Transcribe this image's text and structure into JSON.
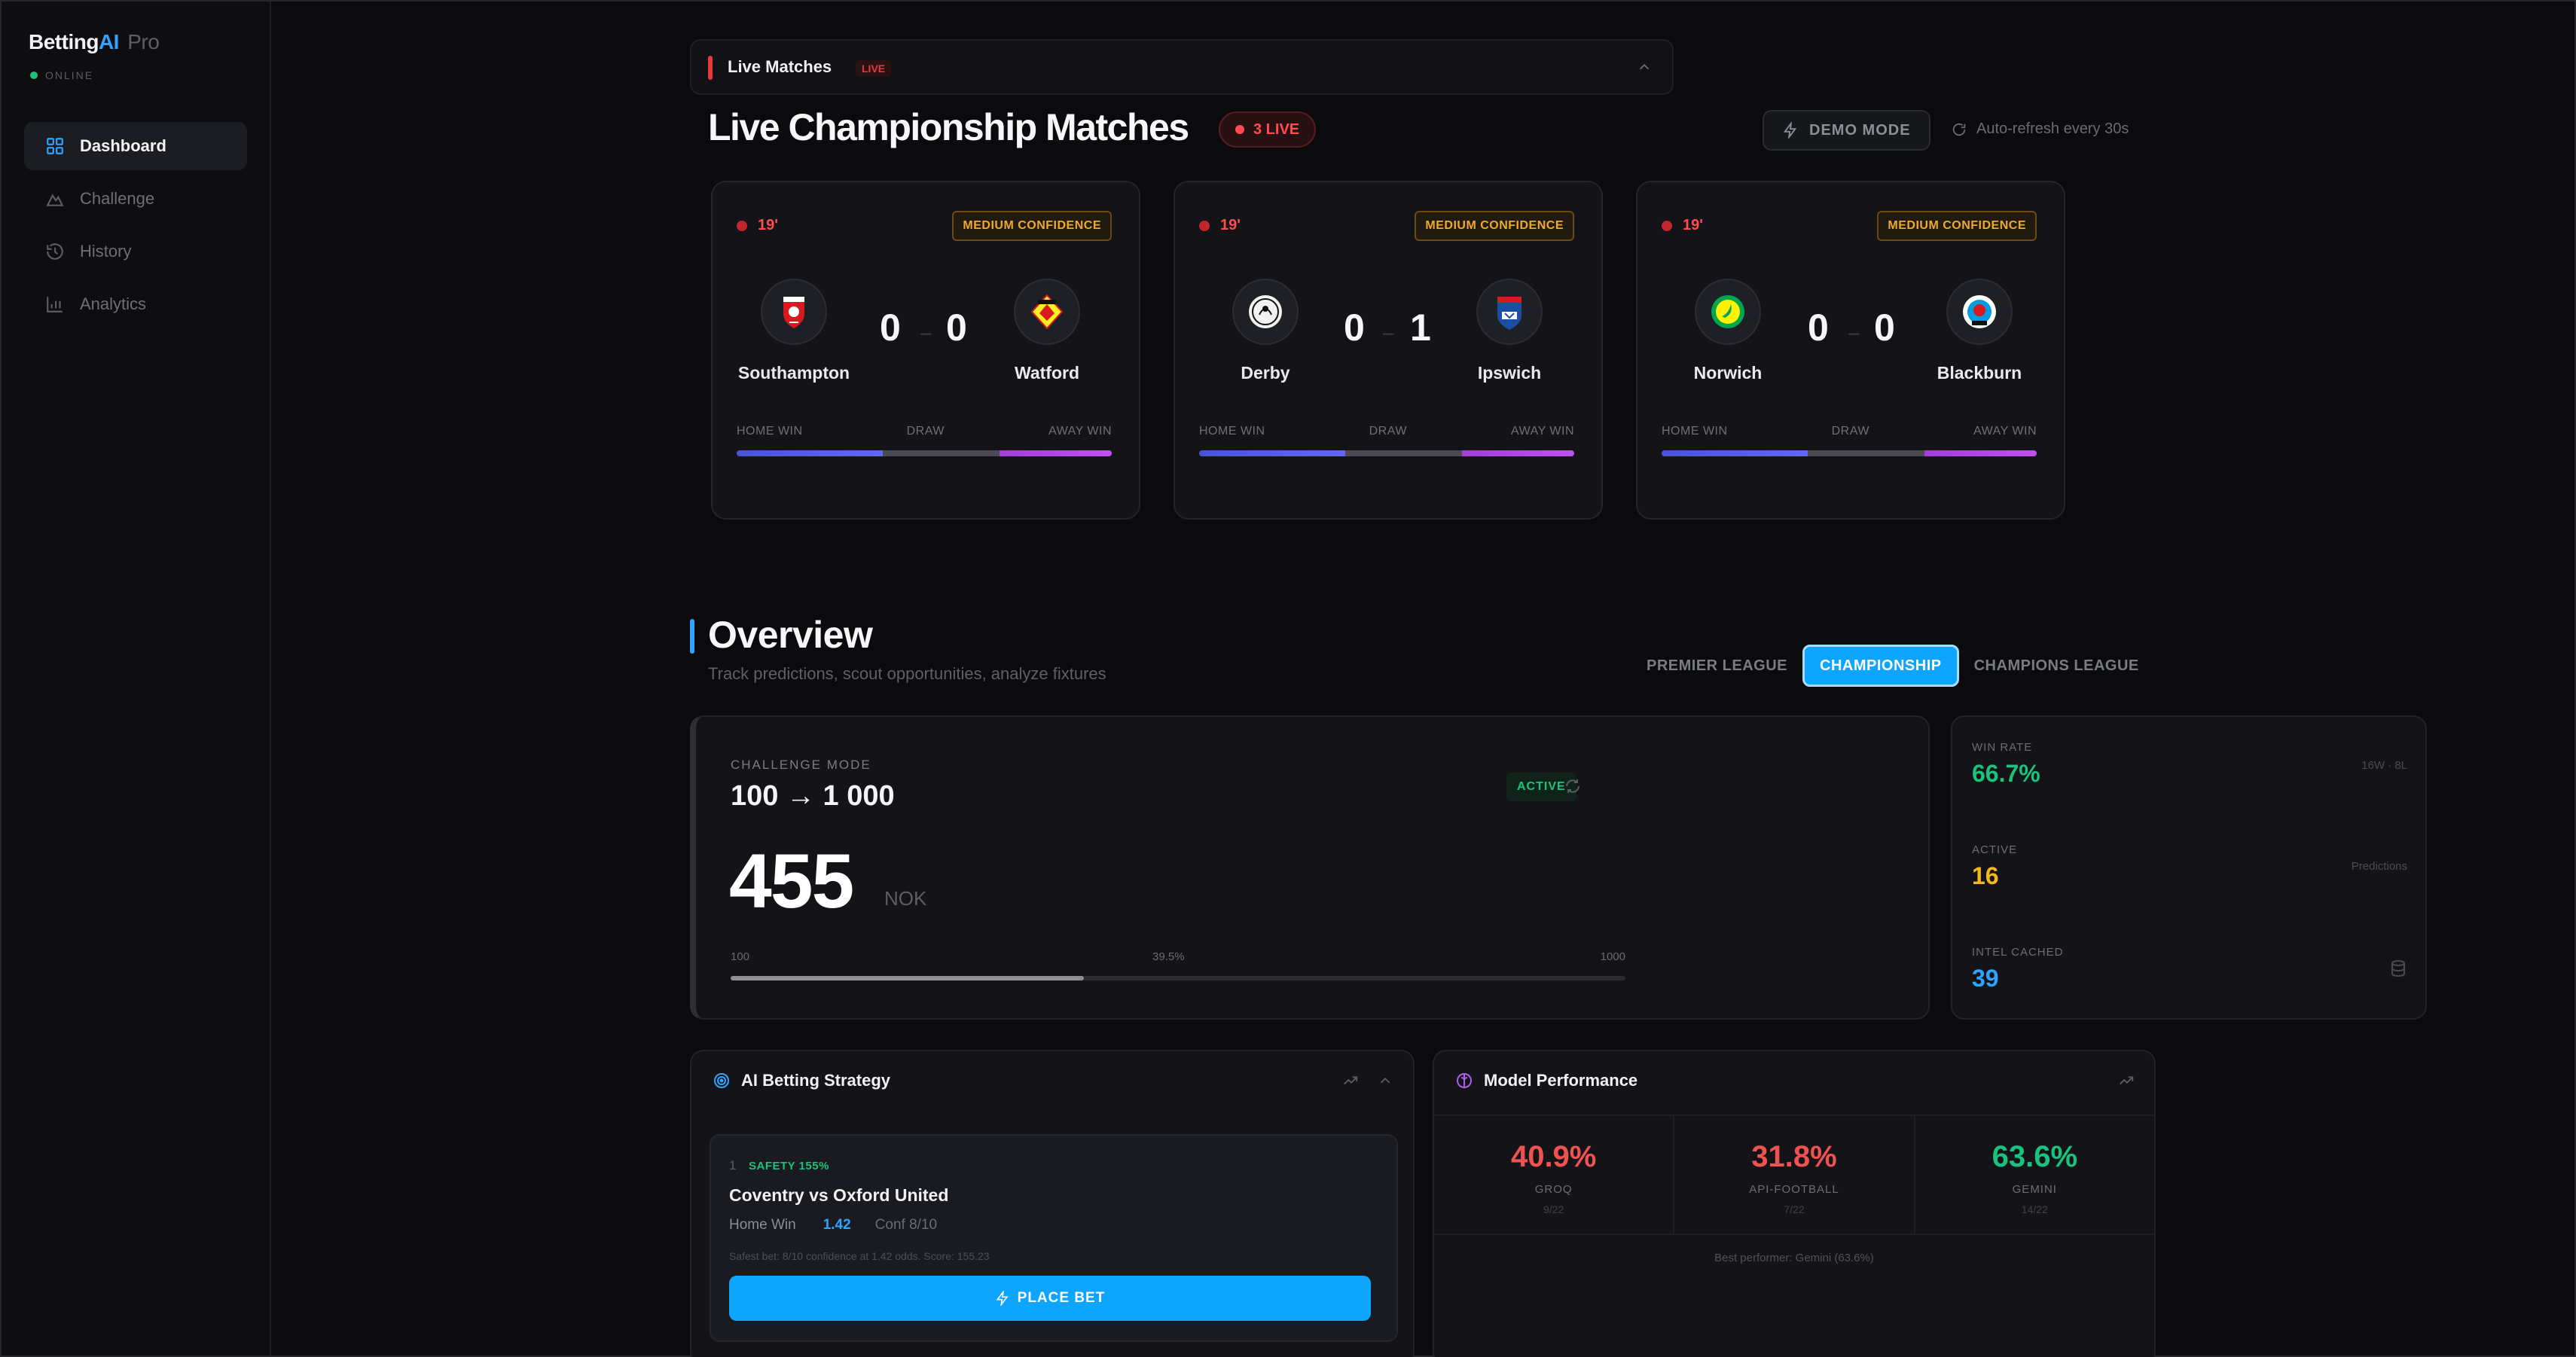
{
  "sidebar": {
    "brand_main": "Betting",
    "brand_ai": "AI",
    "brand_pro": "Pro",
    "status": "ONLINE",
    "items": [
      {
        "label": "Dashboard",
        "icon": "grid-icon",
        "active": true
      },
      {
        "label": "Challenge",
        "icon": "mountain-icon",
        "active": false
      },
      {
        "label": "History",
        "icon": "history-icon",
        "active": false
      },
      {
        "label": "Analytics",
        "icon": "bar-chart-icon",
        "active": false
      }
    ]
  },
  "live_panel": {
    "title": "Live Matches",
    "tag": "LIVE",
    "heading": "Live Championship Matches",
    "live_count": "3 LIVE",
    "demo_mode": "DEMO MODE",
    "auto_refresh": "Auto-refresh every 30s"
  },
  "matches": [
    {
      "minute": "19'",
      "confidence": "MEDIUM CONFIDENCE",
      "home": "Southampton",
      "away": "Watford",
      "home_score": "0",
      "away_score": "0",
      "home_win": 0.39,
      "draw": 0.31,
      "away_win": 0.3
    },
    {
      "minute": "19'",
      "confidence": "MEDIUM CONFIDENCE",
      "home": "Derby",
      "away": "Ipswich",
      "home_score": "0",
      "away_score": "1",
      "home_win": 0.39,
      "draw": 0.31,
      "away_win": 0.3
    },
    {
      "minute": "19'",
      "confidence": "MEDIUM CONFIDENCE",
      "home": "Norwich",
      "away": "Blackburn",
      "home_score": "0",
      "away_score": "0",
      "home_win": 0.39,
      "draw": 0.31,
      "away_win": 0.3
    }
  ],
  "prob_labels": {
    "home": "HOME WIN",
    "draw": "DRAW",
    "away": "AWAY WIN"
  },
  "overview": {
    "title": "Overview",
    "subtitle": "Track predictions, scout opportunities, analyze fixtures",
    "tabs": [
      {
        "label": "PREMIER LEAGUE",
        "active": false
      },
      {
        "label": "CHAMPIONSHIP",
        "active": true
      },
      {
        "label": "CHAMPIONS LEAGUE",
        "active": false
      }
    ]
  },
  "challenge": {
    "label": "CHALLENGE MODE",
    "goal": "100 → 1 000",
    "balance": "455",
    "currency": "NOK",
    "status": "ACTIVE",
    "start": "100",
    "progress_label": "39.5%",
    "progress": 0.395,
    "target": "1000"
  },
  "stats": {
    "win_rate_label": "WIN RATE",
    "win_rate": "66.7%",
    "record": "16W · 8L",
    "active_label": "ACTIVE",
    "active": "16",
    "active_note": "Predictions",
    "cached_label": "INTEL CACHED",
    "cached": "39"
  },
  "strategy": {
    "title": "AI Betting Strategy",
    "rank": "1",
    "safety": "SAFETY 155%",
    "match": "Coventry vs Oxford United",
    "market": "Home Win",
    "odds": "1.42",
    "confidence": "Conf 8/10",
    "reason": "Safest bet: 8/10 confidence at 1.42 odds. Score: 155.23",
    "button": "PLACE BET"
  },
  "performance": {
    "title": "Model Performance",
    "models": [
      {
        "pct": "40.9%",
        "name": "GROQ",
        "score": "9/22",
        "color": "#f05252"
      },
      {
        "pct": "31.8%",
        "name": "API-FOOTBALL",
        "score": "7/22",
        "color": "#f05252"
      },
      {
        "pct": "63.6%",
        "name": "GEMINI",
        "score": "14/22",
        "color": "#19c37d"
      }
    ],
    "best": "Best performer: Gemini (63.6%)"
  },
  "colors": {
    "accent": "#0ea5ff",
    "live": "#ff4d4f",
    "success": "#19c37d",
    "warning": "#f0a928",
    "active_yellow": "#f5b91f"
  }
}
